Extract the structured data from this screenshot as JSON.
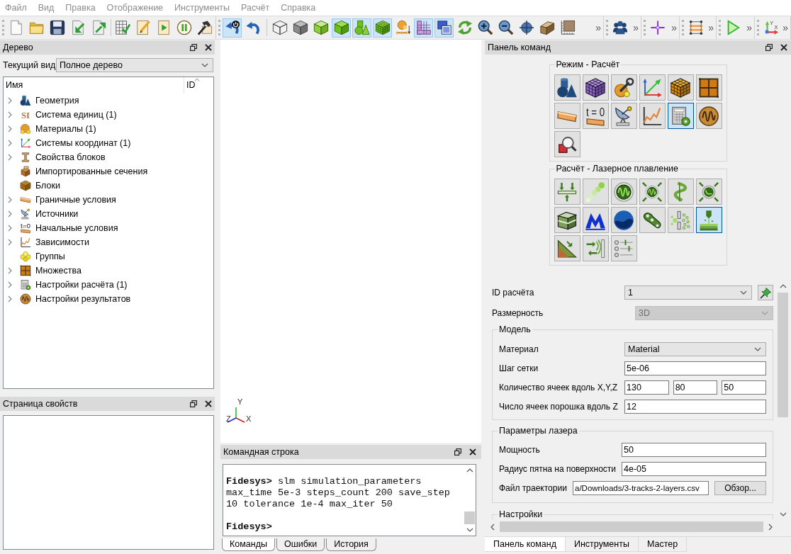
{
  "menu": [
    "Файл",
    "Вид",
    "Правка",
    "Отображение",
    "Инструменты",
    "Расчёт",
    "Справка"
  ],
  "toolbar": {
    "groups": [
      {
        "sections": [
          {
            "buttons": [
              {
                "selected": false
              },
              {
                "selected": false
              },
              {
                "selected": false
              },
              {
                "selected": false
              },
              {
                "selected": false
              }
            ]
          },
          {
            "buttons": [
              {
                "selected": false
              },
              {
                "selected": false
              },
              {
                "selected": false
              },
              {
                "selected": false
              },
              {
                "selected": false
              }
            ]
          }
        ]
      },
      {
        "sections": [
          {
            "buttons": [
              {
                "selected": true
              },
              {
                "selected": false
              }
            ]
          },
          {
            "buttons": [
              {
                "selected": false
              },
              {
                "selected": false
              },
              {
                "selected": false
              },
              {
                "selected": true
              },
              {
                "selected": true
              },
              {
                "selected": true
              },
              {
                "selected": false
              },
              {
                "selected": true
              },
              {
                "selected": true
              },
              {
                "selected": false
              },
              {
                "selected": false
              },
              {
                "selected": false
              },
              {
                "selected": false
              },
              {
                "selected": false
              },
              {
                "selected": false
              }
            ]
          }
        ],
        "overflow": "»"
      },
      {
        "sections": [
          {
            "buttons": [
              {
                "selected": false
              }
            ]
          }
        ],
        "overflow": "»"
      },
      {
        "sections": [
          {
            "buttons": [
              {
                "selected": false
              }
            ]
          }
        ],
        "overflow": "»"
      },
      {
        "sections": [
          {
            "buttons": [
              {
                "selected": false
              }
            ]
          }
        ],
        "overflow": "»"
      },
      {
        "sections": [
          {
            "buttons": [
              {
                "selected": false
              }
            ]
          }
        ],
        "overflow": "»"
      },
      {
        "sections": [
          {
            "buttons": [
              {
                "selected": false,
                "icon_labels": [
                  "Y",
                  "X"
                ]
              }
            ]
          }
        ],
        "overflow": "»"
      }
    ]
  },
  "tree_panel": {
    "title": "Дерево",
    "view_label": "Текущий вид",
    "view_value": "Полное дерево",
    "columns": [
      {
        "label": "Имя",
        "sorted": false
      },
      {
        "label": "ID",
        "sorted": true
      }
    ],
    "items": [
      {
        "label": "Геометрия",
        "expandable": true
      },
      {
        "label": "Система единиц (1)",
        "expandable": true,
        "icon_text": "SI"
      },
      {
        "label": "Материалы (1)",
        "expandable": true
      },
      {
        "label": "Системы координат (1)",
        "expandable": true
      },
      {
        "label": "Свойства блоков",
        "expandable": true
      },
      {
        "label": "Импортированные сечения",
        "expandable": false
      },
      {
        "label": "Блоки",
        "expandable": false
      },
      {
        "label": "Граничные условия",
        "expandable": true
      },
      {
        "label": "Источники",
        "expandable": true
      },
      {
        "label": "Начальные условия",
        "expandable": true,
        "icon_text": "t=0"
      },
      {
        "label": "Зависимости",
        "expandable": true
      },
      {
        "label": "Группы",
        "expandable": false
      },
      {
        "label": "Множества",
        "expandable": true
      },
      {
        "label": "Настройки расчёта (1)",
        "expandable": true
      },
      {
        "label": "Настройки результатов",
        "expandable": true
      }
    ]
  },
  "properties_panel": {
    "title": "Страница свойств"
  },
  "viewport": {
    "axis_labels": {
      "y": "Y",
      "z": "Z",
      "x": "X"
    }
  },
  "command_line": {
    "title": "Командная строка",
    "log": [
      {
        "prompt": "Fidesys>",
        "command": "slm simulation_parameters max_time 5e-3 steps_count 200 save_step 10 tolerance 1e-4 max_iter 50"
      },
      {
        "prompt": "Fidesys>"
      }
    ],
    "tabs": [
      {
        "label": "Команды",
        "selected": true
      },
      {
        "label": "Ошибки",
        "selected": false
      },
      {
        "label": "История",
        "selected": false
      }
    ]
  },
  "command_panel": {
    "title": "Панель команд",
    "groups": [
      {
        "title": "Режим - Расчёт",
        "buttons": [
          {
            "selected": false
          },
          {
            "selected": false
          },
          {
            "selected": false
          },
          {
            "selected": false
          },
          {
            "selected": false
          },
          {
            "selected": false
          },
          {
            "selected": false
          },
          {
            "selected": false,
            "icon_text": "t = 0"
          },
          {
            "selected": false
          },
          {
            "selected": false
          },
          {
            "selected": true
          },
          {
            "selected": false
          },
          {
            "selected": false
          }
        ]
      },
      {
        "title": "Расчёт - Лазерное плавление",
        "buttons": [
          {
            "selected": false
          },
          {
            "selected": false
          },
          {
            "selected": false
          },
          {
            "selected": false
          },
          {
            "selected": false
          },
          {
            "selected": false
          },
          {
            "selected": false
          },
          {
            "selected": false
          },
          {
            "selected": false
          },
          {
            "selected": false
          },
          {
            "selected": false
          },
          {
            "selected": true
          },
          {
            "selected": false
          },
          {
            "selected": false
          },
          {
            "selected": false
          }
        ]
      }
    ],
    "form": {
      "top_rows": [
        {
          "kind": "dropdown",
          "label": "ID расчёта",
          "value": "1",
          "disabled": false,
          "tool_button": true
        },
        {
          "kind": "dropdown",
          "label": "Размерность",
          "value": "3D",
          "disabled": true
        }
      ],
      "sections": [
        {
          "title": "Модель",
          "rows": [
            {
              "kind": "dropdown",
              "label": "Материал",
              "value": "Material",
              "disabled": false
            },
            {
              "kind": "input",
              "label": "Шаг сетки",
              "values": [
                "5e-06"
              ],
              "disabled": false
            },
            {
              "kind": "input",
              "label": "Количество ячеек вдоль X,Y,Z",
              "values": [
                "130",
                "80",
                "50"
              ],
              "disabled": false
            },
            {
              "kind": "input",
              "label": "Число ячеек порошка вдоль Z",
              "values": [
                "12"
              ],
              "disabled": false
            }
          ]
        },
        {
          "title": "Параметры лазера",
          "rows": [
            {
              "kind": "input",
              "label": "Мощность",
              "values": [
                "50"
              ],
              "disabled": false
            },
            {
              "kind": "input",
              "label": "Радиус пятна на поверхности",
              "values": [
                "4e-05"
              ],
              "disabled": false
            },
            {
              "kind": "file",
              "label": "Файл траектории",
              "value": "a/Downloads/3-tracks-2-layers.csv",
              "button": "Обзор...",
              "disabled": false
            }
          ]
        },
        {
          "title": "Настройки"
        }
      ]
    },
    "tabs": [
      {
        "label": "Панель команд",
        "selected": true
      },
      {
        "label": "Инструменты",
        "selected": false
      },
      {
        "label": "Мастер",
        "selected": false
      }
    ]
  }
}
